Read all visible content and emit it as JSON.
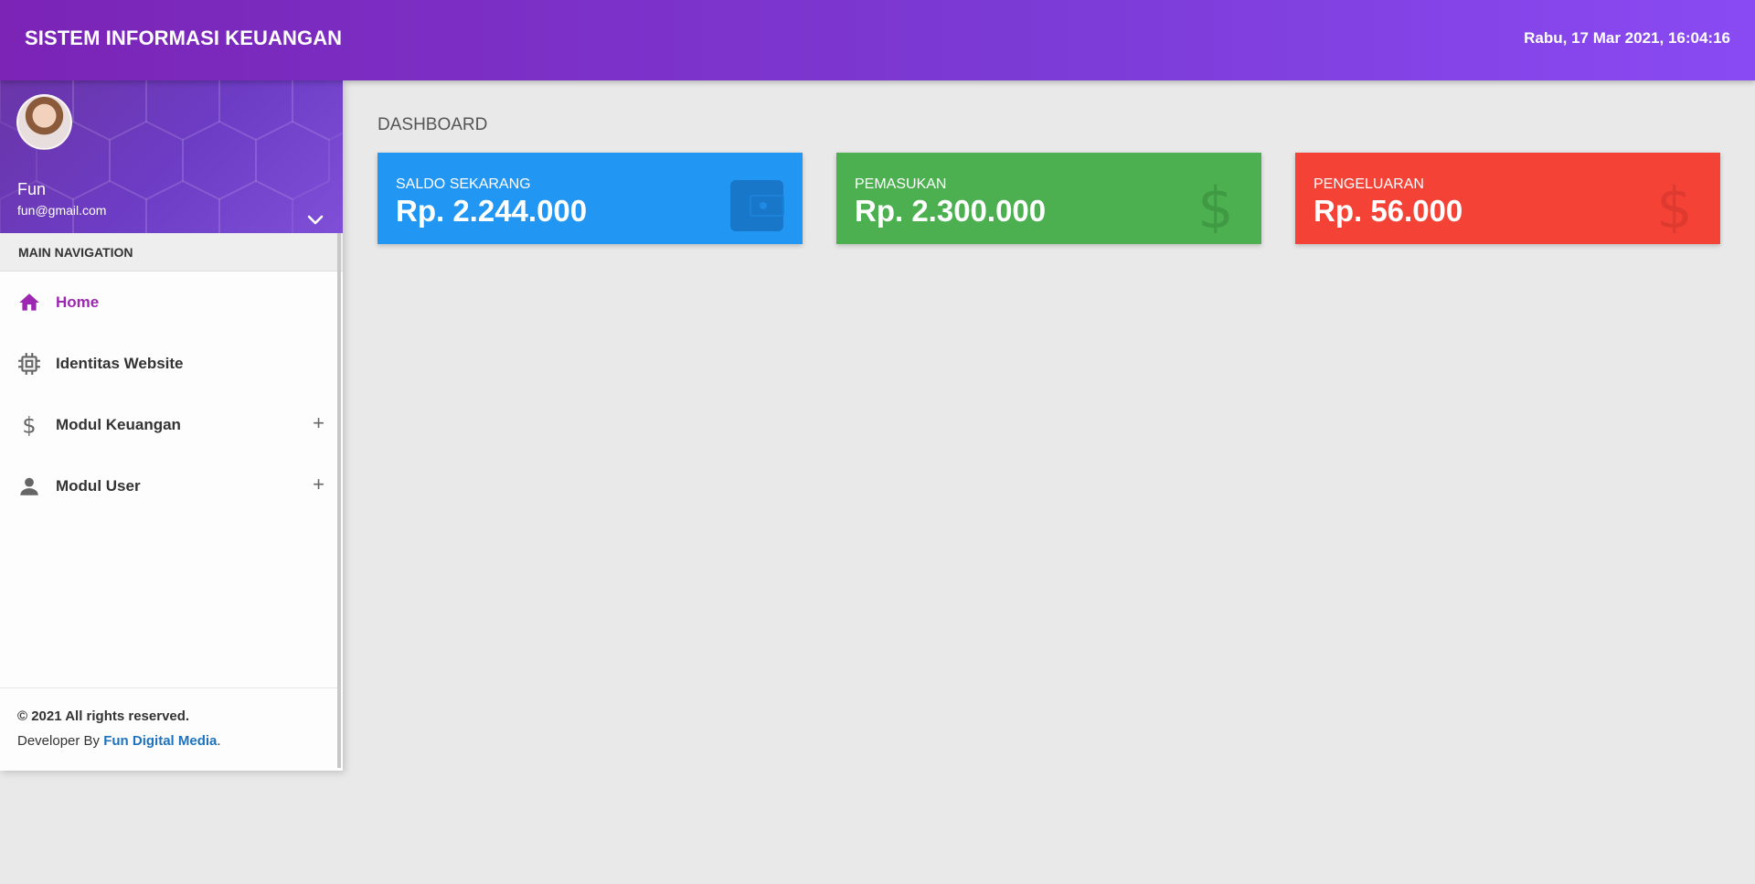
{
  "app": {
    "title": "SISTEM INFORMASI KEUANGAN",
    "datetime": "Rabu, 17 Mar 2021, 16:04:16"
  },
  "user": {
    "name": "Fun",
    "email": "fun@gmail.com"
  },
  "sidebar": {
    "header": "MAIN NAVIGATION",
    "items": [
      {
        "label": "Home",
        "icon": "home-icon",
        "active": true
      },
      {
        "label": "Identitas Website",
        "icon": "chip-icon"
      },
      {
        "label": "Modul Keuangan",
        "icon": "dollar-icon",
        "expand": "+"
      },
      {
        "label": "Modul User",
        "icon": "person-icon",
        "expand": "+"
      }
    ]
  },
  "footer": {
    "copyright": "© 2021 All rights reserved.",
    "developer_prefix": "Developer By ",
    "developer_name": "Fun Digital Media",
    "developer_suffix": "."
  },
  "main": {
    "title": "DASHBOARD",
    "cards": [
      {
        "title": "SALDO SEKARANG",
        "value": "Rp. 2.244.000",
        "color": "#2196f3",
        "icon": "wallet-icon"
      },
      {
        "title": "PEMASUKAN",
        "value": "Rp. 2.300.000",
        "color": "#4caf50",
        "icon": "dollar-icon"
      },
      {
        "title": "PENGELUARAN",
        "value": "Rp. 56.000",
        "color": "#f44336",
        "icon": "dollar-icon"
      }
    ]
  },
  "colors": {
    "accent": "#9c27b0",
    "topbar_start": "#7b24b6",
    "topbar_end": "#8a4af3"
  }
}
